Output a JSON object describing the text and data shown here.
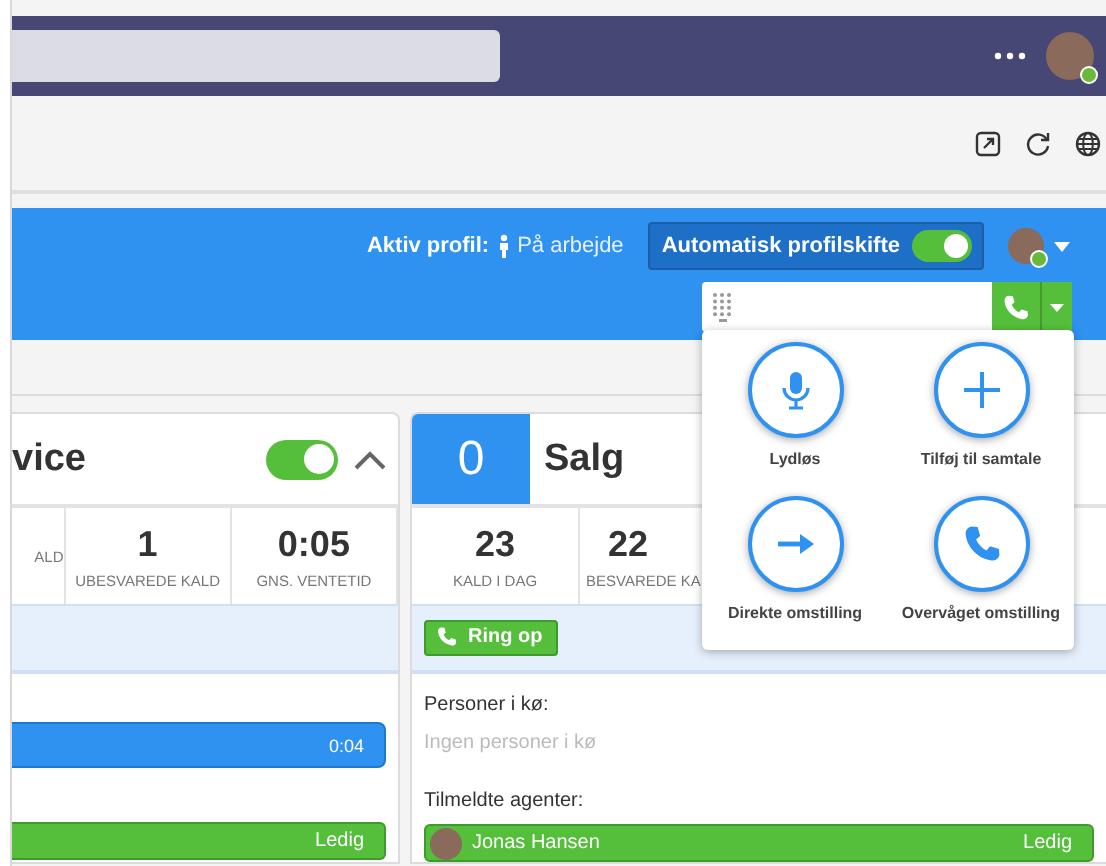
{
  "app_bar": {
    "user": {
      "online": true
    }
  },
  "profile_bar": {
    "label": "Aktiv profil:",
    "profile": "På arbejde",
    "auto_switch": {
      "label": "Automatisk profilskifte",
      "on": true
    },
    "user": {
      "online": true
    }
  },
  "dialer": {
    "open": true
  },
  "call_actions": [
    {
      "label": "Lydløs",
      "kind": "mute"
    },
    {
      "label": "Tilføj til samtale",
      "kind": "add"
    },
    {
      "label": "Direkte omstilling",
      "kind": "transfer"
    },
    {
      "label": "Overvåget omstilling",
      "kind": "attended"
    }
  ],
  "queues": [
    {
      "title": "vice",
      "on": true,
      "expanded": true,
      "stats": [
        {
          "label": "ALD"
        },
        {
          "value": "1",
          "label": "UBESVAREDE KALD"
        },
        {
          "value": "0:05",
          "label": "GNS. VENTETID"
        }
      ],
      "calls": [
        {
          "time": "0:04"
        }
      ],
      "agents": [
        {
          "status": "Ledig"
        }
      ]
    },
    {
      "count": "0",
      "title": "Salg",
      "stats": [
        {
          "value": "23",
          "label": "KALD I DAG"
        },
        {
          "value": "22",
          "label": "BESVAREDE KA"
        }
      ],
      "call_button": "Ring op",
      "queue_heading": "Personer i kø:",
      "queue_empty": "Ingen personer i kø",
      "agents_heading": "Tilmeldte agenter:",
      "agents": [
        {
          "name": "Jonas Hansen",
          "status": "Ledig"
        }
      ]
    }
  ]
}
